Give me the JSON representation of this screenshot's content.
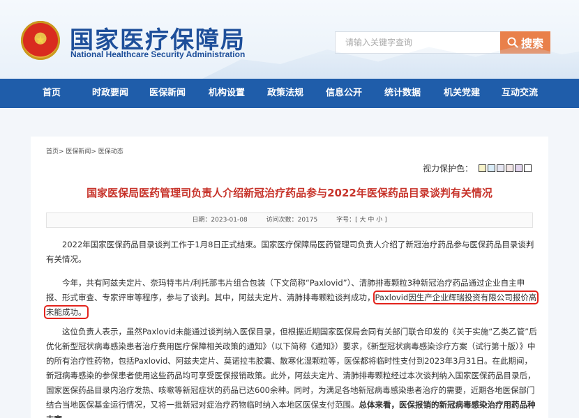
{
  "header": {
    "emblem_glyph": "★",
    "title": "国家医疗保障局",
    "subtitle": "National Healthcare Security Administration",
    "search_placeholder": "请输入关键字查询",
    "search_button": "搜索"
  },
  "nav": {
    "items": [
      "首页",
      "时政要闻",
      "医保新闻",
      "机构设置",
      "政策法规",
      "信息公开",
      "统计数据",
      "机关党建",
      "互动交流"
    ]
  },
  "breadcrumb": "首页> 医保新闻> 医保动态",
  "vision": {
    "label": "视力保护色：",
    "swatches": [
      "#f6f2c9",
      "#d9ecf8",
      "#e6e6f2",
      "#f2e6e6",
      "#e2d6ee",
      "#ffffff"
    ]
  },
  "article": {
    "title": "国家医保局医药管理司负责人介绍新冠治疗药品参与2022年医保药品目录谈判有关情况",
    "meta": {
      "date": "日期：2023-01-08",
      "views": "访问次数：20175",
      "font_size": "字号：[ 大 中 小 ]"
    },
    "p1": "2022年国家医保药品目录谈判工作于1月8日正式结束。国家医疗保障局医药管理司负责人介绍了新冠治疗药品参与医保药品目录谈判有关情况。",
    "p2_before": "今年，共有阿兹夫定片、奈玛特韦片/利托那韦片组合包装（下文简称“Paxlovid”）、清肺排毒颗粒3种新冠治疗药品通过企业自主申报、形式审查、专家评审等程序，参与了谈判。其中，阿兹夫定片、清肺排毒颗粒谈判成功，",
    "p2_highlight": "Paxlovid因生产企业辉瑞投资有限公司报价高未能成功。",
    "p3_normal": "这位负责人表示，虽然Paxlovid未能通过谈判纳入医保目录，但根据近期国家医保局会同有关部门联合印发的《关于实施“乙类乙管”后优化新型冠状病毒感染患者治疗费用医疗保障相关政策的通知》（以下简称《通知》）要求，《新型冠状病毒感染诊疗方案（试行第十版）》中的所有治疗性药物，包括Paxlovid、阿兹夫定片、莫诺拉韦胶囊、散寒化湿颗粒等，医保都将临时性支付到2023年3月31日。在此期间，新冠病毒感染的参保患者使用这些药品均可享受医保报销政策。此外，阿兹夫定片、清肺排毒颗粒经过本次谈判纳入国家医保药品目录后，国家医保药品目录内治疗发热、咳嗽等新冠症状的药品已达600余种。同时，为满足各地新冠病毒感染患者治疗的需要，近期各地医保部门结合当地医保基金运行情况，又将一批新冠对症治疗药物临时纳入本地区医保支付范围。",
    "p3_bold": "总体来看，医保报销的新冠病毒感染治疗用药品种丰富。"
  },
  "colors": {
    "nav_bg": "#1f5daa",
    "title_blue": "#1e4f9a",
    "article_title_red": "#c7332a",
    "search_btn": "#e9804a",
    "highlight_border": "#e3231c"
  }
}
